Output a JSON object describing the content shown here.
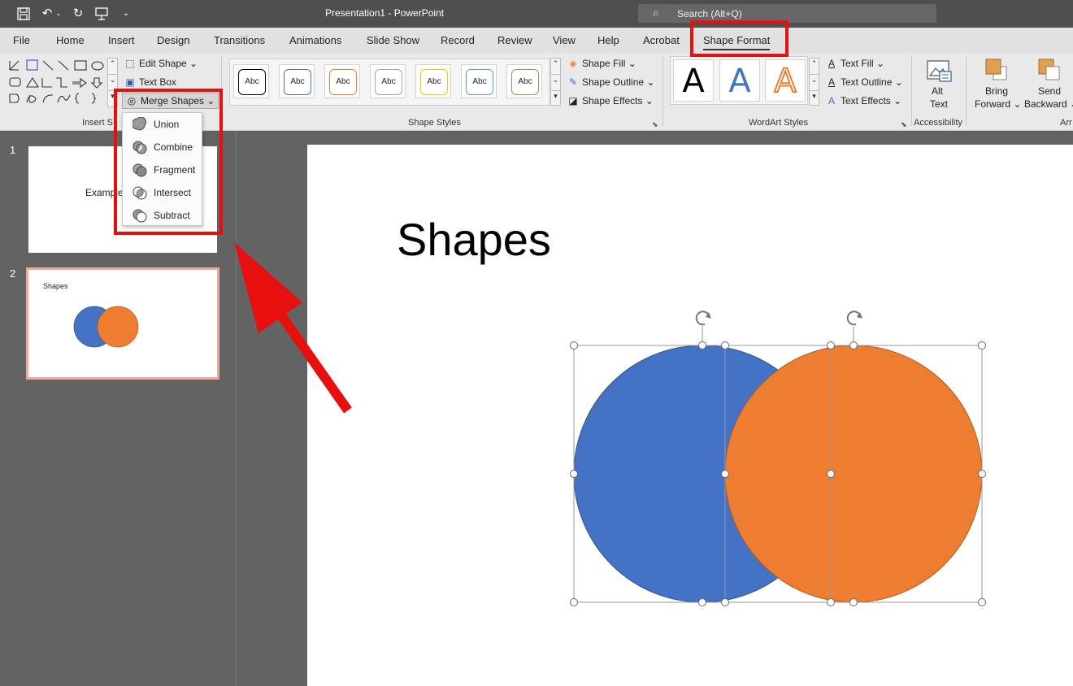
{
  "window": {
    "title": "Presentation1  -  PowerPoint",
    "search_placeholder": "Search (Alt+Q)"
  },
  "tabs": [
    "File",
    "Home",
    "Insert",
    "Design",
    "Transitions",
    "Animations",
    "Slide Show",
    "Record",
    "Review",
    "View",
    "Help",
    "Acrobat",
    "Shape Format"
  ],
  "active_tab": "Shape Format",
  "ribbon": {
    "insert_shapes": {
      "label": "Insert Shapes",
      "edit_shape": "Edit Shape",
      "text_box": "Text Box",
      "merge_shapes": "Merge Shapes"
    },
    "shape_styles": {
      "label": "Shape Styles",
      "sample_text": "Abc",
      "style_colors": [
        "#000000",
        "#4472c4",
        "#ed7d31",
        "#a5a5a5",
        "#ffc000",
        "#5b9bd5",
        "#70ad47"
      ],
      "shape_fill": "Shape Fill",
      "shape_outline": "Shape Outline",
      "shape_effects": "Shape Effects"
    },
    "wordart_styles": {
      "label": "WordArt Styles",
      "sample_letter": "A",
      "text_fill": "Text Fill",
      "text_outline": "Text Outline",
      "text_effects": "Text Effects"
    },
    "accessibility": {
      "label": "Accessibility",
      "alt_text_line1": "Alt",
      "alt_text_line2": "Text"
    },
    "arrange": {
      "label": "Arr",
      "bring_forward_line1": "Bring",
      "bring_forward_line2": "Forward",
      "send_backward_line1": "Send",
      "send_backward_line2": "Backward"
    }
  },
  "merge_menu": {
    "items": [
      "Union",
      "Combine",
      "Fragment",
      "Intersect",
      "Subtract"
    ]
  },
  "thumbnails": [
    {
      "number": "1",
      "text": "Example"
    },
    {
      "number": "2",
      "text": "Shapes"
    }
  ],
  "slide": {
    "title": "Shapes"
  },
  "colors": {
    "blue_circle": "#4472c4",
    "orange_circle": "#ed7d31",
    "highlight_red": "#e8100f"
  }
}
